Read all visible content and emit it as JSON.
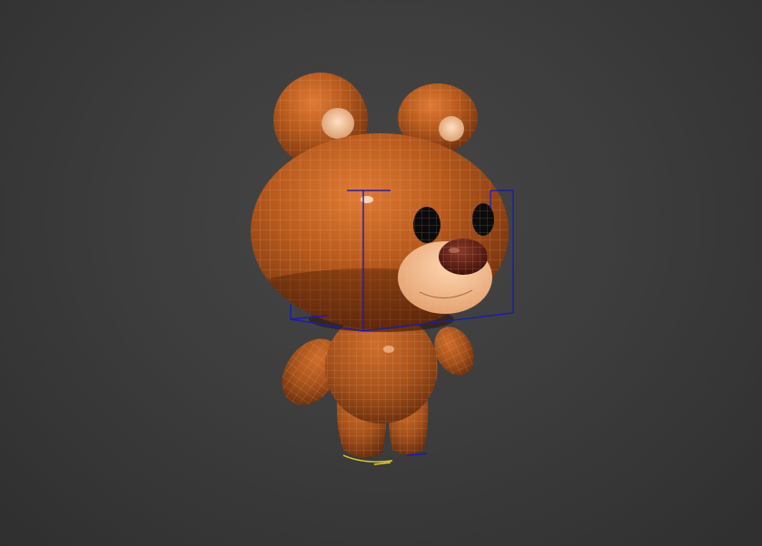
{
  "viewport": {
    "background": "#3b3b3b",
    "object": "bear-character-mesh",
    "display_mode": "smooth-shaded-with-wireframe",
    "selection_bbox_color": "#1a1aa8",
    "colors": {
      "fur": "#b85a1c",
      "fur_dark": "#7a3410",
      "muzzle": "#f0b88a",
      "inner_ear": "#f3c9a0",
      "nose": "#5a1a10",
      "eye": "#0b0b0b",
      "wire": "#d9b49a",
      "ground_marker": "#e8d020"
    }
  }
}
